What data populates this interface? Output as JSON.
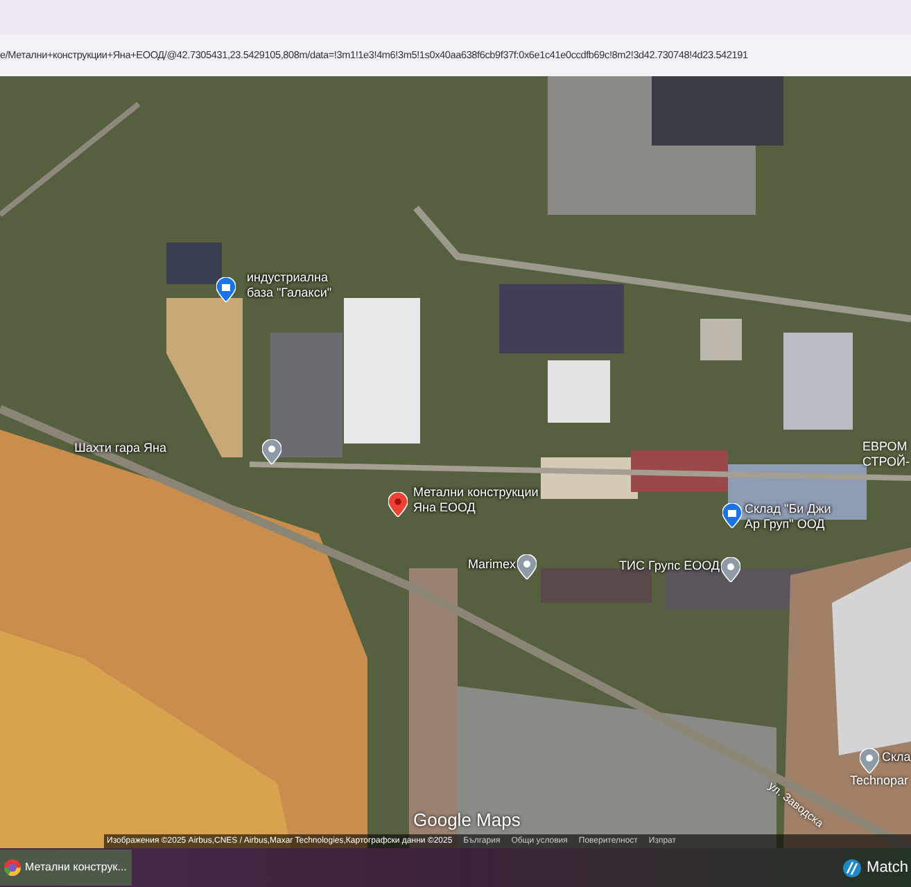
{
  "address_bar": {
    "url": "e/Метални+конструкции+Яна+ЕООД/@42.7305431,23.5429105,808m/data=!3m1!1e3!4m6!3m5!1s0x40aa638f6cb9f37f:0x6e1c41e0ccdfb69c!8m2!3d42.730748!4d23.542191"
  },
  "map": {
    "places": [
      {
        "name": "индустриална\nбаза \"Галакси\"",
        "kind": "shop"
      },
      {
        "name": "Шахти гара Яна",
        "kind": "place"
      },
      {
        "name": "Метални конструкции\nЯна ЕООД",
        "kind": "selected"
      },
      {
        "name": "Склад \"Би Джи\nАр Груп\" ООД",
        "kind": "shop"
      },
      {
        "name": "Marimex",
        "kind": "place"
      },
      {
        "name": "ТИС Групс ЕООД",
        "kind": "place"
      },
      {
        "name": "Скла",
        "kind": "place"
      }
    ],
    "labels": [
      {
        "text": "ЕВРОМ\nСТРОЙ-",
        "kind": "area"
      },
      {
        "text": "Technopar",
        "kind": "area"
      },
      {
        "text": "ул. Заводска",
        "kind": "road"
      }
    ],
    "brand": "Google Maps",
    "footer": [
      "Изображения ©2025 Airbus,CNES / Airbus,Maxar Technologies,Картографски данни ©2025",
      "България",
      "Общи условия",
      "Поверителност",
      "Изпрат"
    ]
  },
  "taskbar": {
    "window_title": "Метални конструк...",
    "tray_app": "Match"
  }
}
